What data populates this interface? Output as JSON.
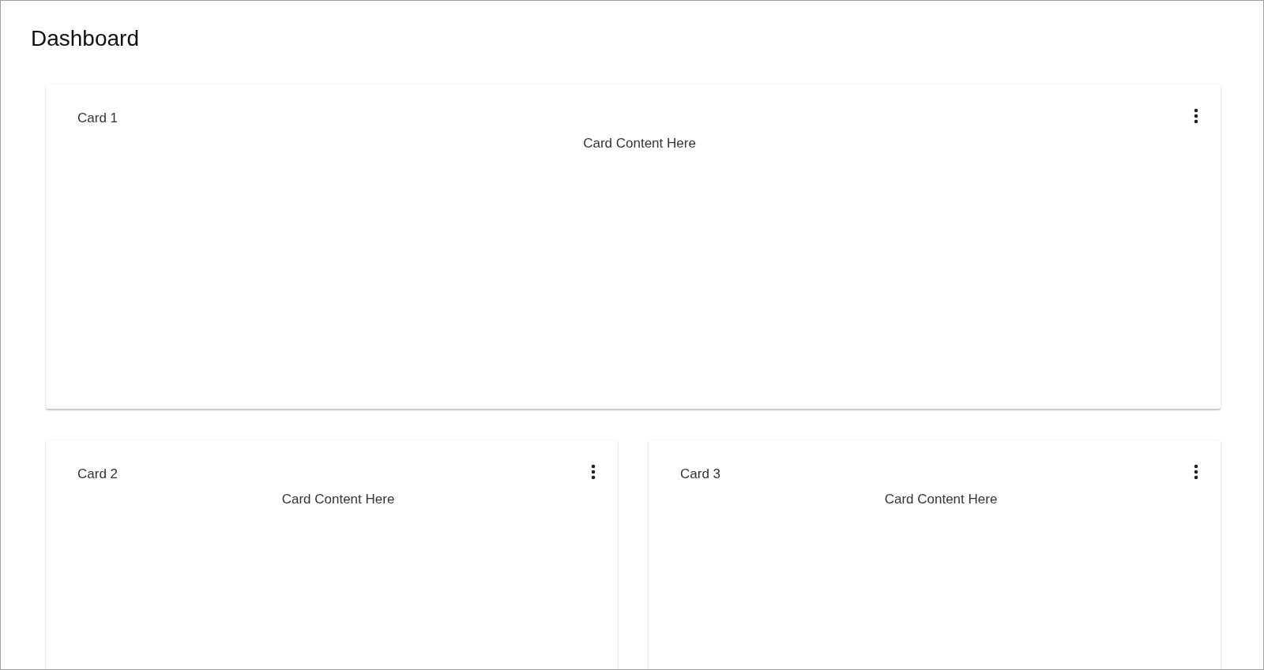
{
  "title": "Dashboard",
  "cards": [
    {
      "kind": "wide",
      "title": "Card 1",
      "content": "Card Content Here"
    },
    {
      "kind": "half",
      "title": "Card 2",
      "content": "Card Content Here"
    },
    {
      "kind": "half",
      "title": "Card 3",
      "content": "Card Content Here"
    }
  ]
}
